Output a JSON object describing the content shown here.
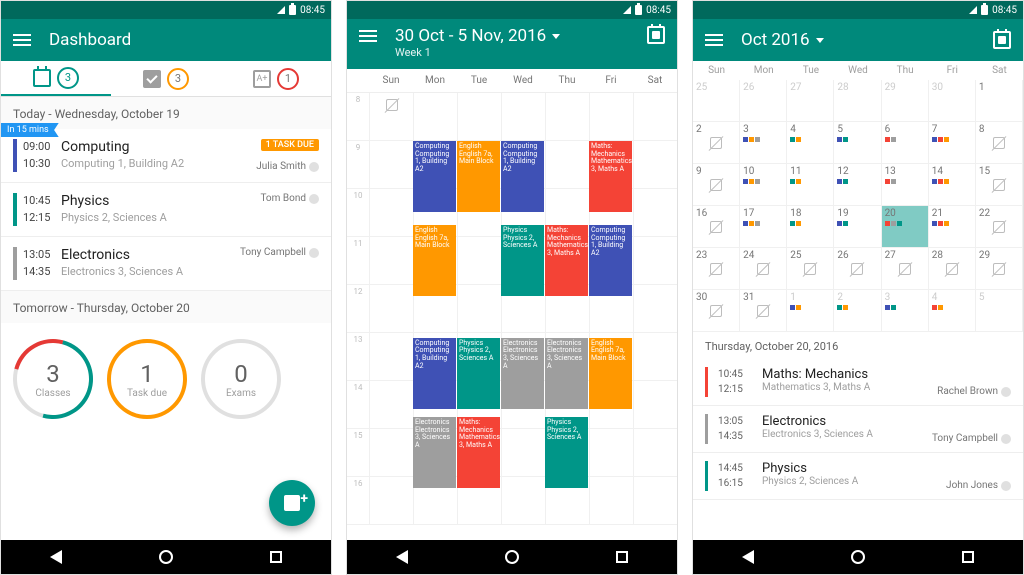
{
  "status": {
    "time": "08:45"
  },
  "colors": {
    "teal": "#00897b",
    "blue": "#3f51b5",
    "orange": "#ff9800",
    "grey": "#9e9e9e",
    "red": "#f44336",
    "green": "#009688"
  },
  "screen1": {
    "title": "Dashboard",
    "tabs": [
      {
        "icon": "calendar",
        "badge": "3",
        "color": "g"
      },
      {
        "icon": "check",
        "badge": "3",
        "color": "o"
      },
      {
        "icon": "exam",
        "badge": "1",
        "color": "r"
      }
    ],
    "today_header": "Today - Wednesday, October 19",
    "banner": "In 15 mins",
    "classes": [
      {
        "start": "09:00",
        "end": "10:30",
        "course": "Computing",
        "loc": "Computing 1, Building A2",
        "teacher": "Julia Smith",
        "color": "#3f51b5",
        "pill": "1 TASK DUE"
      },
      {
        "start": "10:45",
        "end": "12:15",
        "course": "Physics",
        "loc": "Physics 2, Sciences A",
        "teacher": "Tom Bond",
        "color": "#009688"
      },
      {
        "start": "13:05",
        "end": "14:35",
        "course": "Electronics",
        "loc": "Electronics 3, Sciences A",
        "teacher": "Tony Campbell",
        "color": "#9e9e9e"
      }
    ],
    "tomorrow_header": "Tomorrow - Thursday, October 20",
    "rings": [
      {
        "num": "3",
        "lbl": "Classes",
        "style": "multi"
      },
      {
        "num": "1",
        "lbl": "Task due",
        "style": "orange"
      },
      {
        "num": "0",
        "lbl": "Exams",
        "style": "grey"
      }
    ]
  },
  "screen2": {
    "range": "30 Oct - 5 Nov, 2016",
    "week": "Week 1",
    "days": [
      "Sun",
      "Mon",
      "Tue",
      "Wed",
      "Thu",
      "Fri",
      "Sat"
    ],
    "hours": [
      "8",
      "9",
      "10",
      "11",
      "12",
      "13",
      "14",
      "15",
      "16"
    ],
    "events": [
      {
        "day": 1,
        "h": 9,
        "len": 1.5,
        "c": "#3f51b5",
        "t": "Computing Computing 1, Building A2"
      },
      {
        "day": 2,
        "h": 9,
        "len": 1.5,
        "c": "#ff9800",
        "t": "English English 7a, Main Block"
      },
      {
        "day": 3,
        "h": 9,
        "len": 1.5,
        "c": "#3f51b5",
        "t": "Computing Computing 1, Building A2"
      },
      {
        "day": 5,
        "h": 9,
        "len": 1.5,
        "c": "#f44336",
        "t": "Maths: Mechanics Mathematics 3, Maths A"
      },
      {
        "day": 1,
        "h": 10.75,
        "len": 1.5,
        "c": "#ff9800",
        "t": "English English 7a, Main Block"
      },
      {
        "day": 3,
        "h": 10.75,
        "len": 1.5,
        "c": "#009688",
        "t": "Physics Physics 2, Sciences A"
      },
      {
        "day": 4,
        "h": 10.75,
        "len": 1.5,
        "c": "#f44336",
        "t": "Maths: Mechanics Mathematics 3, Maths A"
      },
      {
        "day": 5,
        "h": 10.75,
        "len": 1.5,
        "c": "#3f51b5",
        "t": "Computing Computing 1, Building A2"
      },
      {
        "day": 1,
        "h": 13.1,
        "len": 1.5,
        "c": "#3f51b5",
        "t": "Computing Computing 1, Building A2"
      },
      {
        "day": 2,
        "h": 13.1,
        "len": 1.5,
        "c": "#009688",
        "t": "Physics Physics 2, Sciences A"
      },
      {
        "day": 3,
        "h": 13.1,
        "len": 1.5,
        "c": "#9e9e9e",
        "t": "Electronics Electronics 3, Sciences A"
      },
      {
        "day": 4,
        "h": 13.1,
        "len": 1.5,
        "c": "#9e9e9e",
        "t": "Electronics Electronics 3, Sciences A"
      },
      {
        "day": 5,
        "h": 13.1,
        "len": 1.5,
        "c": "#ff9800",
        "t": "English English 7a, Main Block"
      },
      {
        "day": 1,
        "h": 14.75,
        "len": 1.5,
        "c": "#9e9e9e",
        "t": "Electronics Electronics 3, Sciences A"
      },
      {
        "day": 2,
        "h": 14.75,
        "len": 1.5,
        "c": "#f44336",
        "t": "Maths: Mechanics Mathematics 3, Maths A"
      },
      {
        "day": 4,
        "h": 14.75,
        "len": 1.5,
        "c": "#009688",
        "t": "Physics Physics 2, Sciences A"
      }
    ]
  },
  "screen3": {
    "title": "Oct 2016",
    "days": [
      "Sun",
      "Mon",
      "Tue",
      "Wed",
      "Thu",
      "Fri",
      "Sat"
    ],
    "grid": [
      [
        {
          "n": "25",
          "dim": 1
        },
        {
          "n": "26",
          "dim": 1
        },
        {
          "n": "27",
          "dim": 1
        },
        {
          "n": "28",
          "dim": 1
        },
        {
          "n": "29",
          "dim": 1
        },
        {
          "n": "30",
          "dim": 1
        },
        {
          "n": "1"
        }
      ],
      [
        {
          "n": "2",
          "s": 1
        },
        {
          "n": "3",
          "d": [
            "#3f51b5",
            "#ff9800",
            "#9e9e9e"
          ]
        },
        {
          "n": "4",
          "d": [
            "#009688",
            "#ff9800"
          ]
        },
        {
          "n": "5",
          "d": [
            "#3f51b5",
            "#009688"
          ]
        },
        {
          "n": "6",
          "d": [
            "#f44336",
            "#9e9e9e"
          ]
        },
        {
          "n": "7",
          "d": [
            "#3f51b5",
            "#f44336",
            "#ff9800"
          ]
        },
        {
          "n": "8",
          "s": 1
        }
      ],
      [
        {
          "n": "9",
          "s": 1
        },
        {
          "n": "10",
          "d": [
            "#3f51b5",
            "#ff9800",
            "#9e9e9e"
          ]
        },
        {
          "n": "11",
          "d": [
            "#009688",
            "#ff9800"
          ]
        },
        {
          "n": "12",
          "d": [
            "#3f51b5",
            "#009688"
          ]
        },
        {
          "n": "13",
          "d": [
            "#f44336",
            "#9e9e9e"
          ]
        },
        {
          "n": "14",
          "d": [
            "#3f51b5",
            "#f44336",
            "#ff9800"
          ]
        },
        {
          "n": "15",
          "s": 1
        }
      ],
      [
        {
          "n": "16",
          "s": 1
        },
        {
          "n": "17",
          "d": [
            "#3f51b5",
            "#ff9800",
            "#9e9e9e"
          ]
        },
        {
          "n": "18",
          "d": [
            "#009688",
            "#ff9800"
          ]
        },
        {
          "n": "19",
          "d": [
            "#3f51b5",
            "#009688"
          ]
        },
        {
          "n": "20",
          "sel": 1,
          "d": [
            "#f44336",
            "#9e9e9e",
            "#009688"
          ]
        },
        {
          "n": "21",
          "d": [
            "#3f51b5",
            "#f44336",
            "#ff9800"
          ]
        },
        {
          "n": "22",
          "s": 1
        }
      ],
      [
        {
          "n": "23",
          "s": 1
        },
        {
          "n": "24",
          "s": 1
        },
        {
          "n": "25",
          "s": 1
        },
        {
          "n": "26",
          "s": 1
        },
        {
          "n": "27",
          "s": 1
        },
        {
          "n": "28",
          "s": 1
        },
        {
          "n": "29",
          "s": 1
        }
      ],
      [
        {
          "n": "30",
          "s": 1
        },
        {
          "n": "31",
          "s": 1
        },
        {
          "n": "1",
          "dim": 1,
          "d": [
            "#3f51b5",
            "#ff9800"
          ]
        },
        {
          "n": "2",
          "dim": 1,
          "d": [
            "#009688",
            "#ff9800"
          ]
        },
        {
          "n": "3",
          "dim": 1,
          "d": [
            "#3f51b5",
            "#009688"
          ]
        },
        {
          "n": "4",
          "dim": 1,
          "d": [
            "#f44336",
            "#ff9800"
          ]
        },
        {
          "n": "5",
          "dim": 1
        }
      ]
    ],
    "selected_header": "Thursday, October 20, 2016",
    "items": [
      {
        "c": "#f44336",
        "start": "10:45",
        "end": "12:15",
        "course": "Maths: Mechanics",
        "loc": "Mathematics 3, Maths A",
        "teacher": "Rachel Brown"
      },
      {
        "c": "#9e9e9e",
        "start": "13:05",
        "end": "14:35",
        "course": "Electronics",
        "loc": "Electronics 3, Sciences A",
        "teacher": "Tony Campbell"
      },
      {
        "c": "#009688",
        "start": "14:45",
        "end": "16:15",
        "course": "Physics",
        "loc": "Physics 2, Sciences A",
        "teacher": "John Jones"
      }
    ]
  }
}
